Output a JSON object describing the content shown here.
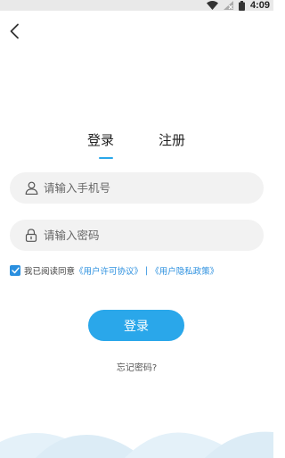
{
  "status_bar": {
    "time": "4:09",
    "icons": [
      "wifi-icon",
      "signal-off-icon",
      "battery-icon"
    ]
  },
  "header": {
    "back_icon": "chevron-left-icon"
  },
  "tabs": [
    {
      "label": "登录",
      "active": true
    },
    {
      "label": "注册",
      "active": false
    }
  ],
  "form": {
    "phone": {
      "placeholder": "请输入手机号",
      "value": "",
      "icon": "user-icon"
    },
    "password": {
      "placeholder": "请输入密码",
      "value": "",
      "icon": "lock-icon"
    }
  },
  "agreement": {
    "checked": true,
    "prefix": "我已阅读同意",
    "user_agreement": "《用户许可协议》",
    "separator": "|",
    "privacy_policy": "《用户隐私政策》"
  },
  "login_button": {
    "label": "登录"
  },
  "forgot_password": {
    "label": "忘记密码?"
  },
  "colors": {
    "accent": "#2aa7ea",
    "link": "#2a8fdf",
    "field_bg": "#f2f2f2",
    "wave": "#dcecf6"
  }
}
